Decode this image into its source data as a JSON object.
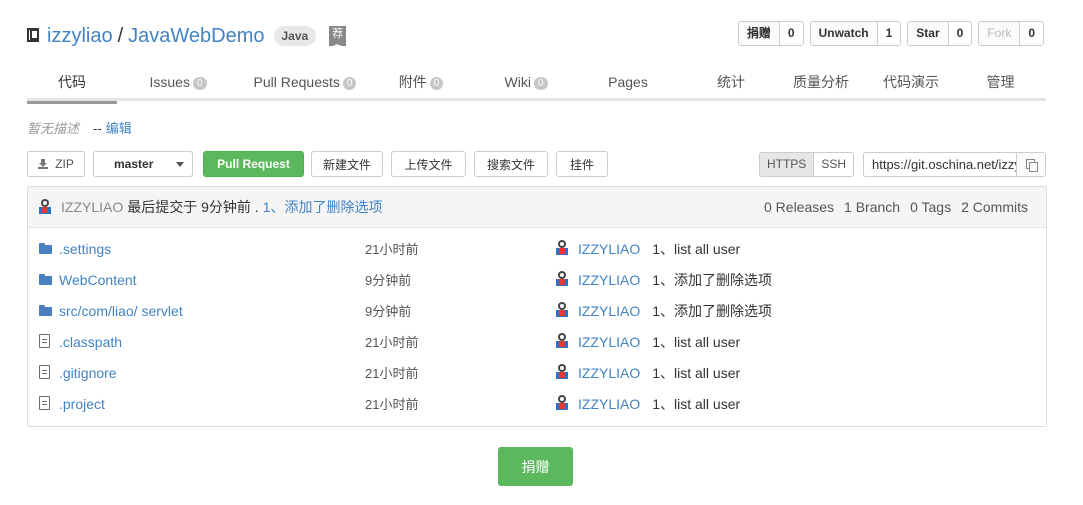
{
  "repo": {
    "owner": "izzyliao",
    "separator": "/",
    "name": "JavaWebDemo",
    "language": "Java",
    "recommend_badge": "荐"
  },
  "stats": [
    {
      "label": "捐赠",
      "count": "0",
      "disabled": false
    },
    {
      "label": "Unwatch",
      "count": "1",
      "disabled": false
    },
    {
      "label": "Star",
      "count": "0",
      "disabled": false
    },
    {
      "label": "Fork",
      "count": "0",
      "disabled": true
    }
  ],
  "tabs": [
    {
      "label": "代码",
      "count": null,
      "active": true
    },
    {
      "label": "Issues",
      "count": "0"
    },
    {
      "label": "Pull Requests",
      "count": "0"
    },
    {
      "label": "附件",
      "count": "0"
    },
    {
      "label": "Wiki",
      "count": "0"
    },
    {
      "label": "Pages",
      "count": null
    },
    {
      "label": "统计",
      "count": null
    },
    {
      "label": "质量分析",
      "count": null
    },
    {
      "label": "代码演示",
      "count": null
    },
    {
      "label": "管理",
      "count": null
    }
  ],
  "description": {
    "empty_text": "暂无描述",
    "separator": "--",
    "edit_link": "编辑"
  },
  "toolbar": {
    "zip_label": "ZIP",
    "branch": "master",
    "pull_request": "Pull Request",
    "new_file": "新建文件",
    "upload_file": "上传文件",
    "search_file": "搜索文件",
    "widget": "挂件"
  },
  "clone": {
    "https_label": "HTTPS",
    "ssh_label": "SSH",
    "url": "https://git.oschina.net/izzyliao/JavaWebDemo.git"
  },
  "latest_commit": {
    "author": "IZZYLIAO",
    "text": "最后提交于 9分钟前 .",
    "message": "1、添加了删除选项",
    "releases": "0 Releases",
    "branches": "1 Branch",
    "tags": "0 Tags",
    "commits": "2 Commits"
  },
  "files": [
    {
      "type": "folder",
      "prefix": "",
      "name": ".settings",
      "age": "21小时前",
      "author": "IZZYLIAO",
      "message": "1、list all user"
    },
    {
      "type": "folder",
      "prefix": "",
      "name": "WebContent",
      "age": "9分钟前",
      "author": "IZZYLIAO",
      "message": "1、添加了删除选项"
    },
    {
      "type": "folder",
      "prefix": "src/com/liao/",
      "name": "servlet",
      "age": "9分钟前",
      "author": "IZZYLIAO",
      "message": "1、添加了删除选项"
    },
    {
      "type": "file",
      "prefix": "",
      "name": ".classpath",
      "age": "21小时前",
      "author": "IZZYLIAO",
      "message": "1、list all user"
    },
    {
      "type": "file",
      "prefix": "",
      "name": ".gitignore",
      "age": "21小时前",
      "author": "IZZYLIAO",
      "message": "1、list all user"
    },
    {
      "type": "file",
      "prefix": "",
      "name": ".project",
      "age": "21小时前",
      "author": "IZZYLIAO",
      "message": "1、list all user"
    }
  ],
  "donate_button": "捐赠"
}
